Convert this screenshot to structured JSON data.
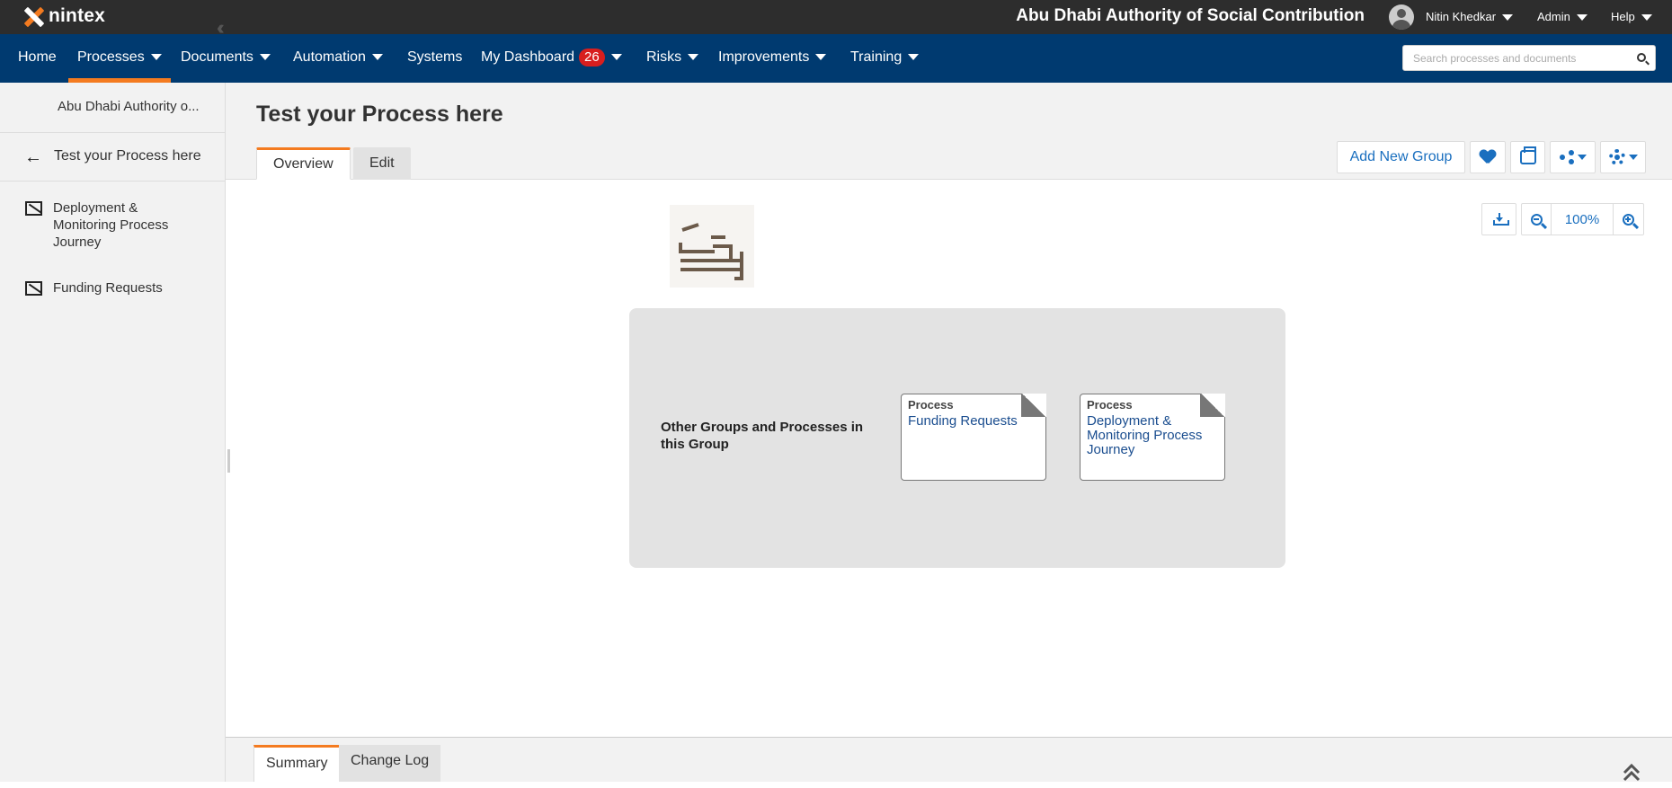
{
  "topbar": {
    "brand": "nintex",
    "org_title": "Abu Dhabi Authority of Social Contribution",
    "user_name": "Nitin Khedkar",
    "admin_label": "Admin",
    "help_label": "Help"
  },
  "nav": {
    "items": [
      {
        "label": "Home"
      },
      {
        "label": "Processes"
      },
      {
        "label": "Documents"
      },
      {
        "label": "Automation"
      },
      {
        "label": "Systems"
      },
      {
        "label": "My Dashboard",
        "badge": "26"
      },
      {
        "label": "Risks"
      },
      {
        "label": "Improvements"
      },
      {
        "label": "Training"
      }
    ],
    "active": "Processes",
    "search_placeholder": "Search processes and documents"
  },
  "sidebar": {
    "header": "Abu Dhabi Authority o...",
    "back_label": "Test your Process here",
    "items": [
      {
        "label": "Deployment & Monitoring Process Journey"
      },
      {
        "label": "Funding Requests"
      }
    ]
  },
  "main": {
    "title": "Test your Process here",
    "tabs": [
      {
        "label": "Overview"
      },
      {
        "label": "Edit"
      }
    ],
    "active_tab": "Overview",
    "add_group_label": "Add New Group",
    "zoom_level": "100%"
  },
  "canvas": {
    "group_label": "Other Groups and Processes in this Group",
    "cards": [
      {
        "type": "Process",
        "name": "Funding Requests"
      },
      {
        "type": "Process",
        "name": "Deployment & Monitoring Process Journey"
      }
    ]
  },
  "bottom": {
    "tabs": [
      {
        "label": "Summary"
      },
      {
        "label": "Change Log"
      }
    ],
    "active_tab": "Summary"
  },
  "colors": {
    "nav_bg": "#003a70",
    "topbar_bg": "#2d2d2d",
    "accent": "#f47b20",
    "link": "#1a6fbf",
    "badge": "#d81e1e"
  }
}
